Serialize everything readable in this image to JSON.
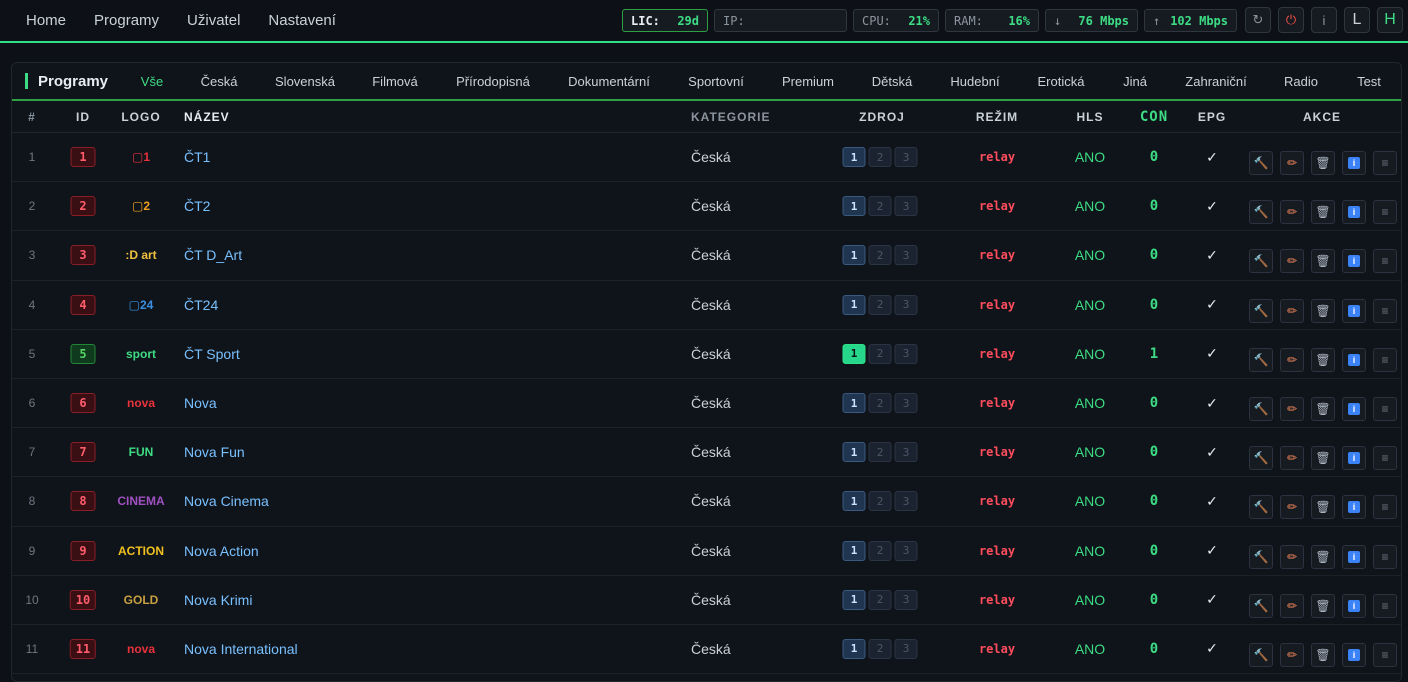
{
  "nav": {
    "items": [
      {
        "label": "Home"
      },
      {
        "label": "Programy"
      },
      {
        "label": "Uživatel"
      },
      {
        "label": "Nastavení"
      }
    ]
  },
  "stats": {
    "lic": {
      "key": "LIC:",
      "value": "29d"
    },
    "ip": {
      "key": "IP:",
      "value": ""
    },
    "cpu": {
      "key": "CPU:",
      "value": "21%"
    },
    "ram": {
      "key": "RAM:",
      "value": "16%"
    },
    "down": {
      "arrow": "↓",
      "value": "76 Mbps"
    },
    "up": {
      "arrow": "↑",
      "value": "102 Mbps"
    }
  },
  "controls": {
    "refresh_icon": "↻",
    "power_icon": "⏻",
    "info_label": "i",
    "l_label": "L",
    "h_label": "H"
  },
  "panel": {
    "title": "Programy",
    "tabs": [
      {
        "label": "Vše",
        "active": true
      },
      {
        "label": "Česká"
      },
      {
        "label": "Slovenská"
      },
      {
        "label": "Filmová"
      },
      {
        "label": "Přírodopisná"
      },
      {
        "label": "Dokumentární"
      },
      {
        "label": "Sportovní"
      },
      {
        "label": "Premium"
      },
      {
        "label": "Dětská"
      },
      {
        "label": "Hudební"
      },
      {
        "label": "Erotická"
      },
      {
        "label": "Jiná"
      },
      {
        "label": "Zahraniční"
      },
      {
        "label": "Radio"
      },
      {
        "label": "Test"
      }
    ]
  },
  "table": {
    "headers": {
      "num": "#",
      "id": "ID",
      "logo": "LOGO",
      "name": "NÁZEV",
      "category": "KATEGORIE",
      "source": "ZDROJ",
      "mode": "REŽIM",
      "hls": "HLS",
      "con": "CON",
      "epg": "EPG",
      "actions": "AKCE"
    },
    "rows": [
      {
        "num": "1",
        "id": "1",
        "logo": "▢1",
        "logo_color": "#e8323c",
        "name": "ČT1",
        "category": "Česká",
        "source": [
          "1",
          "2",
          "3"
        ],
        "active_src": 1,
        "live": false,
        "mode": "relay",
        "hls": "ANO",
        "con": "0",
        "epg": "✓"
      },
      {
        "num": "2",
        "id": "2",
        "logo": "▢2",
        "logo_color": "#f0a020",
        "name": "ČT2",
        "category": "Česká",
        "source": [
          "1",
          "2",
          "3"
        ],
        "active_src": 1,
        "live": false,
        "mode": "relay",
        "hls": "ANO",
        "con": "0",
        "epg": "✓"
      },
      {
        "num": "3",
        "id": "3",
        "logo": ":D art",
        "logo_color": "#f0c040",
        "name": "ČT D_Art",
        "category": "Česká",
        "source": [
          "1",
          "2",
          "3"
        ],
        "active_src": 1,
        "live": false,
        "mode": "relay",
        "hls": "ANO",
        "con": "0",
        "epg": "✓"
      },
      {
        "num": "4",
        "id": "4",
        "logo": "▢24",
        "logo_color": "#3b8fe0",
        "name": "ČT24",
        "category": "Česká",
        "source": [
          "1",
          "2",
          "3"
        ],
        "active_src": 1,
        "live": false,
        "mode": "relay",
        "hls": "ANO",
        "con": "0",
        "epg": "✓"
      },
      {
        "num": "5",
        "id": "5",
        "logo": "sport",
        "logo_color": "#3ddc84",
        "name": "ČT Sport",
        "category": "Česká",
        "source": [
          "1",
          "2",
          "3"
        ],
        "active_src": 1,
        "live": true,
        "ok": true,
        "mode": "relay",
        "hls": "ANO",
        "con": "1",
        "epg": "✓"
      },
      {
        "num": "6",
        "id": "6",
        "logo": "nova",
        "logo_color": "#e8323c",
        "name": "Nova",
        "category": "Česká",
        "source": [
          "1",
          "2",
          "3"
        ],
        "active_src": 1,
        "live": false,
        "mode": "relay",
        "hls": "ANO",
        "con": "0",
        "epg": "✓"
      },
      {
        "num": "7",
        "id": "7",
        "logo": "FUN",
        "logo_color": "#3ddc84",
        "name": "Nova Fun",
        "category": "Česká",
        "source": [
          "1",
          "2",
          "3"
        ],
        "active_src": 1,
        "live": false,
        "mode": "relay",
        "hls": "ANO",
        "con": "0",
        "epg": "✓"
      },
      {
        "num": "8",
        "id": "8",
        "logo": "CINEMA",
        "logo_color": "#a050c0",
        "name": "Nova Cinema",
        "category": "Česká",
        "source": [
          "1",
          "2",
          "3"
        ],
        "active_src": 1,
        "live": false,
        "mode": "relay",
        "hls": "ANO",
        "con": "0",
        "epg": "✓"
      },
      {
        "num": "9",
        "id": "9",
        "logo": "ACTION",
        "logo_color": "#f0c020",
        "name": "Nova Action",
        "category": "Česká",
        "source": [
          "1",
          "2",
          "3"
        ],
        "active_src": 1,
        "live": false,
        "mode": "relay",
        "hls": "ANO",
        "con": "0",
        "epg": "✓"
      },
      {
        "num": "10",
        "id": "10",
        "logo": "GOLD",
        "logo_color": "#c8a040",
        "name": "Nova Krimi",
        "category": "Česká",
        "source": [
          "1",
          "2",
          "3"
        ],
        "active_src": 1,
        "live": false,
        "mode": "relay",
        "hls": "ANO",
        "con": "0",
        "epg": "✓"
      },
      {
        "num": "11",
        "id": "11",
        "logo": "nova",
        "logo_color": "#e8323c",
        "name": "Nova International",
        "category": "Česká",
        "source": [
          "1",
          "2",
          "3"
        ],
        "active_src": 1,
        "live": false,
        "mode": "relay",
        "hls": "ANO",
        "con": "0",
        "epg": "✓"
      }
    ]
  },
  "row_actions": {
    "hammer_icon": "🔨",
    "pencil_icon": "✏",
    "trash_icon": "🗑",
    "info_icon": "i",
    "menu_icon": "≡"
  }
}
